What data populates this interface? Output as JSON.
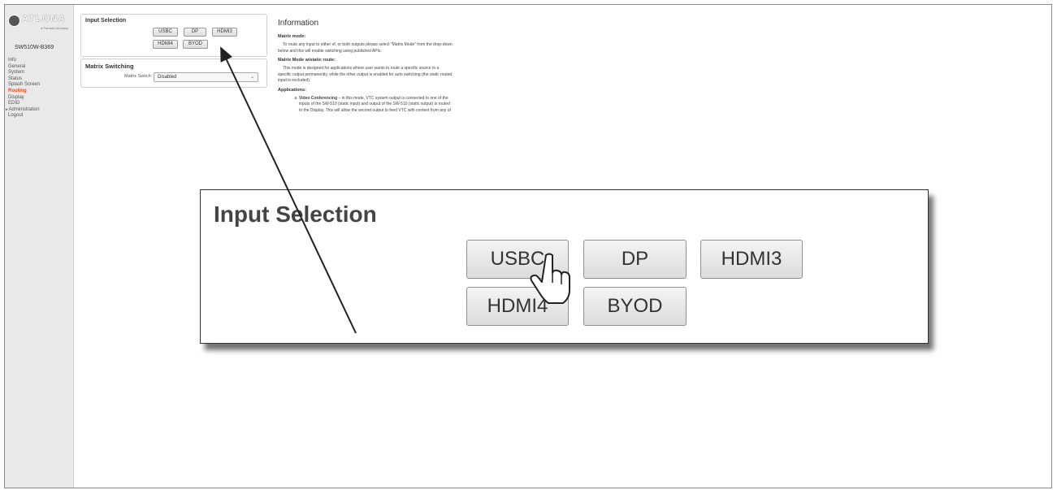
{
  "sidebar": {
    "logo_text": "ATLONA",
    "logo_sub": "a Panduit company",
    "device_name": "SW510W-B369",
    "items": [
      {
        "label": "Info"
      },
      {
        "label": "General"
      },
      {
        "label": "System"
      },
      {
        "label": "Status"
      },
      {
        "label": "Splash Screen"
      },
      {
        "label": "Routing",
        "active": true
      },
      {
        "label": "Display"
      },
      {
        "label": "EDID"
      },
      {
        "label": "Administration",
        "expandable": true
      },
      {
        "label": "Logout"
      }
    ]
  },
  "input_selection": {
    "title": "Input Selection",
    "buttons": [
      "USBC",
      "DP",
      "HDMI3",
      "HDMI4",
      "BYOD"
    ]
  },
  "matrix_switching": {
    "title": "Matrix Switching",
    "field_label": "Matrix Switch:",
    "value": "Disabled"
  },
  "information": {
    "title": "Information",
    "matrix_mode_heading": "Matrix mode:",
    "matrix_mode_text": "To route any input to either of, or both outputs please select \"Matrix Mode\" from the drop-down below and this will enable switching using published APIs.",
    "static_heading": "Matrix Mode w/static route:",
    "static_text": "This mode is designed for applications where user wants to route a specific source to a specific output permanently, while the other output is enabled for auto switching (the static routed input is excluded).",
    "applications_heading": "Applications:",
    "app_a_bold": "Video Conferencing",
    "app_a_text": " – in this mode, VTC system output is connected to one of the inputs of the SW-510 (static input) and output of the SW-510 (static output) is routed to the Display. This will allow the second output to feed VTC with content from any of"
  },
  "zoom": {
    "title": "Input Selection",
    "buttons": [
      "USBC",
      "DP",
      "HDMI3",
      "HDMI4",
      "BYOD"
    ]
  },
  "colors": {
    "active_nav": "#e8501c",
    "sidebar_bg": "#e9e9e9"
  }
}
